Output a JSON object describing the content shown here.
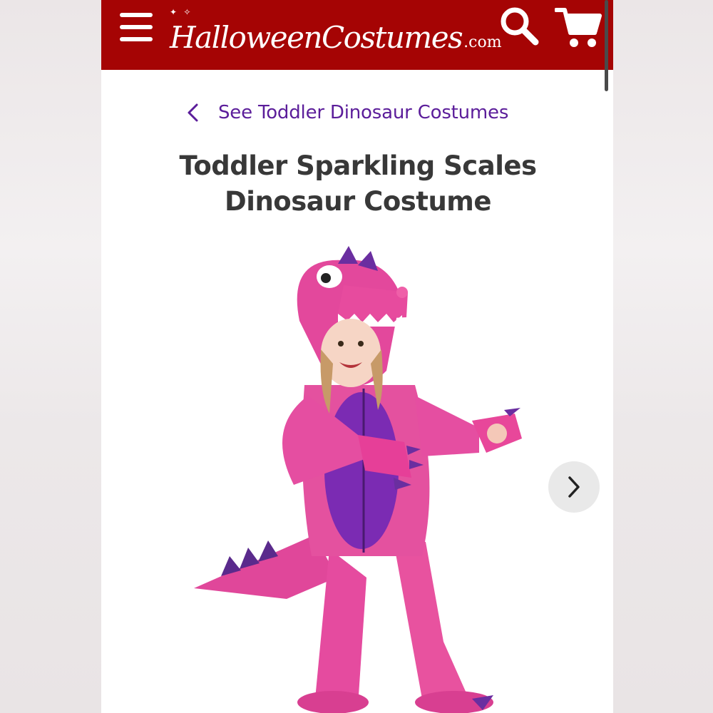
{
  "header": {
    "logo_text": "HalloweenCostumes",
    "logo_suffix": ".com",
    "menu_icon": "hamburger-menu-icon",
    "search_icon": "search-icon",
    "cart_icon": "shopping-cart-icon",
    "background_color": "#a50404"
  },
  "breadcrumb": {
    "label": "See Toddler Dinosaur Costumes",
    "icon": "chevron-left-icon",
    "color": "#5b1d9a"
  },
  "product": {
    "title_line1": "Toddler Sparkling Scales",
    "title_line2": "Dinosaur Costume",
    "image_description_icon": "pink-dinosaur-costume-photo"
  },
  "carousel": {
    "next_icon": "chevron-right-icon"
  }
}
